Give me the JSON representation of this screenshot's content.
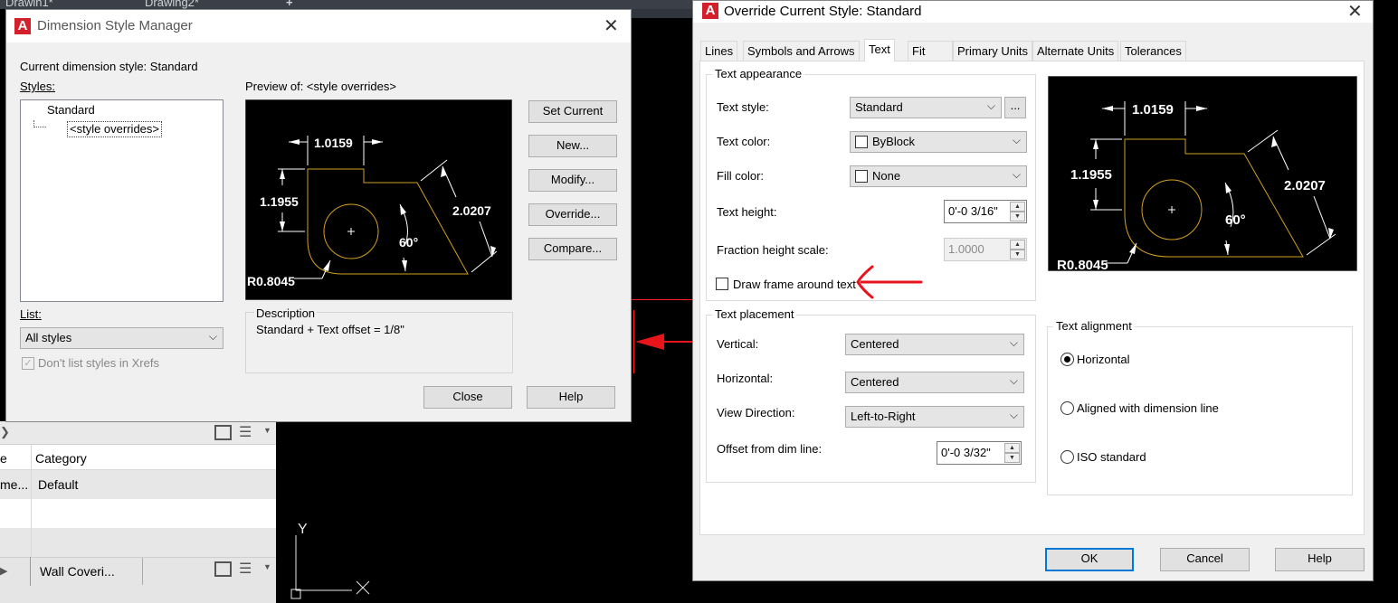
{
  "workspace": {
    "tabs": [
      "Drawin1*",
      "Drawing2*"
    ],
    "new_tab": "+",
    "panel": {
      "col_left": "e",
      "col_category": "Category",
      "row_left": "me...",
      "row_category": "Default",
      "bottom_tab": "Wall Coveri..."
    },
    "ucs_y": "Y"
  },
  "dsm": {
    "title": "Dimension Style Manager",
    "current_style_label": "Current dimension style: Standard",
    "styles_label": "Styles:",
    "styles": [
      "Standard",
      "<style overrides>"
    ],
    "preview_label": "Preview of: <style overrides>",
    "buttons": {
      "set_current": "Set Current",
      "new": "New...",
      "modify": "Modify...",
      "override": "Override...",
      "compare": "Compare...",
      "close": "Close",
      "help": "Help"
    },
    "list_label": "List:",
    "list_value": "All styles",
    "xrefs_label": "Don't list styles in Xrefs",
    "description_label": "Description",
    "description_text": "Standard + Text offset = 1/8\""
  },
  "ocs": {
    "title": "Override Current Style: Standard",
    "tabs": [
      "Lines",
      "Symbols and Arrows",
      "Text",
      "Fit",
      "Primary Units",
      "Alternate Units",
      "Tolerances"
    ],
    "appearance": {
      "group_label": "Text appearance",
      "text_style_label": "Text style:",
      "text_style_value": "Standard",
      "browse": "...",
      "text_color_label": "Text color:",
      "text_color_value": "ByBlock",
      "fill_color_label": "Fill color:",
      "fill_color_value": "None",
      "text_height_label": "Text height:",
      "text_height_value": "0'-0 3/16\"",
      "fraction_label": "Fraction height scale:",
      "fraction_value": "1.0000",
      "frame_label": "Draw frame around text"
    },
    "placement": {
      "group_label": "Text placement",
      "vertical_label": "Vertical:",
      "vertical_value": "Centered",
      "horizontal_label": "Horizontal:",
      "horizontal_value": "Centered",
      "view_label": "View Direction:",
      "view_value": "Left-to-Right",
      "offset_label": "Offset from dim line:",
      "offset_value": "0'-0 3/32\""
    },
    "alignment": {
      "group_label": "Text alignment",
      "options": [
        "Horizontal",
        "Aligned with dimension line",
        "ISO standard"
      ],
      "selected": "Horizontal"
    },
    "buttons": {
      "ok": "OK",
      "cancel": "Cancel",
      "help": "Help"
    }
  },
  "preview_dims": {
    "top": "1.0159",
    "left": "1.1955",
    "angled": "2.0207",
    "angle": "60°",
    "radius": "R0.8045"
  },
  "colors": {
    "annotation": "#e8141c",
    "geometry": "#d1a021",
    "selection": "#0078d7"
  }
}
